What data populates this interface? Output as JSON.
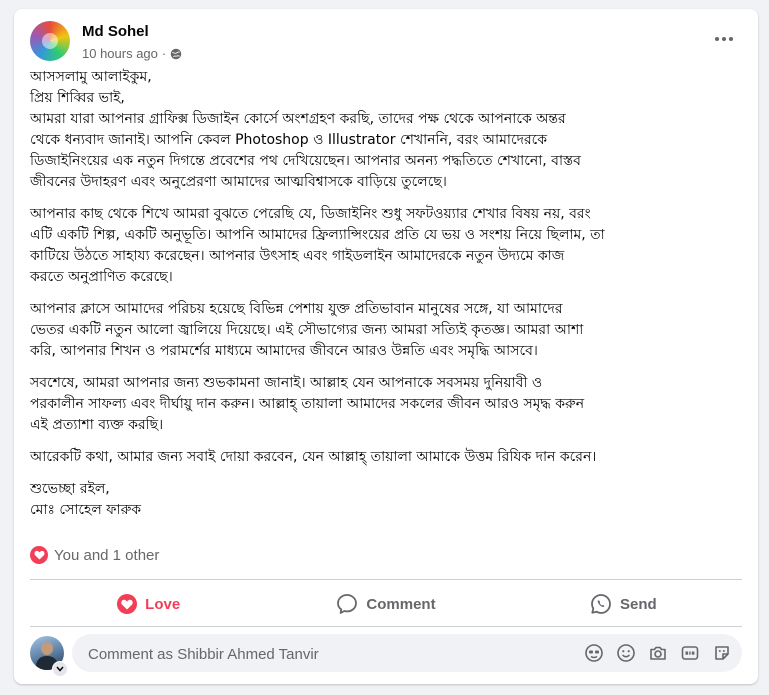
{
  "post": {
    "author": "Md Sohel",
    "time": "10 hours ago",
    "paragraphs": [
      [
        "আসসলামু আলাইকুম,",
        "প্রিয় শিব্বির ভাই,",
        "আমরা যারা আপনার গ্রাফিক্স ডিজাইন কোর্সে অংশগ্রহণ করছি, তাদের পক্ষ থেকে আপনাকে অন্তর",
        "থেকে ধন্যবাদ জানাই। আপনি কেবল Photoshop ও Illustrator শেখাননি, বরং আমাদেরকে",
        "ডিজাইনিংয়ের এক নতুন দিগন্তে প্রবেশের পথ দেখিয়েছেন। আপনার অনন্য পদ্ধতিতে শেখানো, বাস্তব",
        "জীবনের উদাহরণ এবং অনুপ্রেরণা আমাদের আত্মবিশ্বাসকে বাড়িয়ে তুলেছে।"
      ],
      [
        "আপনার কাছ থেকে শিখে আমরা বুঝতে পেরেছি যে, ডিজাইনিং শুধু সফটওয়্যার শেখার বিষয় নয়, বরং",
        "এটি একটি শিল্প, একটি অনুভূতি। আপনি আমাদের ফ্রিল্যান্সিংয়ের প্রতি যে ভয় ও সংশয় নিয়ে ছিলাম, তা",
        "কাটিয়ে উঠতে সাহায্য করেছেন। আপনার উৎসাহ এবং গাইডলাইন আমাদেরকে নতুন উদ্যমে কাজ",
        "করতে অনুপ্রাণিত করেছে।"
      ],
      [
        "আপনার ক্লাসে আমাদের পরিচয় হয়েছে বিভিন্ন পেশায় যুক্ত প্রতিভাবান মানুষের সঙ্গে, যা আমাদের",
        "ভেতর একটি নতুন আলো জ্বালিয়ে দিয়েছে। এই সৌভাগ্যের জন্য আমরা সত্যিই কৃতজ্ঞ। আমরা আশা",
        "করি, আপনার শিখন ও পরামর্শের মাধ্যমে আমাদের জীবনে আরও উন্নতি এবং সমৃদ্ধি আসবে।"
      ],
      [
        "সবশেষে, আমরা আপনার জন্য শুভকামনা জানাই। আল্লাহ যেন আপনাকে সবসময় দুনিয়াবী ও",
        "পরকালীন সাফল্য এবং দীর্ঘায়ু দান করুন। আল্লাহ্‌ তায়ালা আমাদের সকলের জীবন আরও সমৃদ্ধ করুন",
        "এই প্রত্যাশা ব্যক্ত করছি।"
      ],
      [
        "আরেকটি কথা, আমার জন্য সবাই দোয়া করবেন, যেন আল্লাহ্‌ তায়ালা আমাকে উত্তম রিযিক দান করেন।"
      ],
      [
        "শুভেচ্ছা রইল,",
        "মোঃ সোহেল ফারুক"
      ]
    ]
  },
  "reactions": {
    "summary": "You and 1 other"
  },
  "actions": {
    "love": "Love",
    "comment": "Comment",
    "send": "Send"
  },
  "comment_box": {
    "placeholder": "Comment as Shibbir Ahmed Tanvir",
    "value": ""
  },
  "icons": {
    "audience": "globe-icon",
    "more": "more-options-icon",
    "reaction": "heart-icon",
    "comment_tools": [
      "avatar-sticker-icon",
      "emoji-icon",
      "camera-icon",
      "gif-icon",
      "sticker-icon"
    ]
  },
  "colors": {
    "love": "#f33e58",
    "secondary_text": "#65676b",
    "background": "#f0f2f5"
  }
}
